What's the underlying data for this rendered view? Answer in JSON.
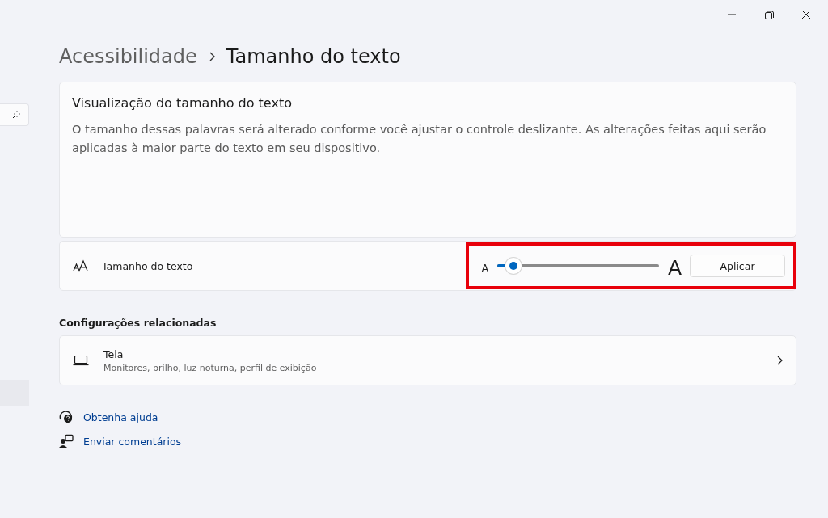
{
  "breadcrumb": {
    "parent": "Acessibilidade",
    "current": "Tamanho do texto"
  },
  "preview": {
    "title": "Visualização do tamanho do texto",
    "body": "O tamanho dessas palavras será alterado conforme você ajustar o controle deslizante. As alterações feitas aqui serão aplicadas à maior parte do texto em seu dispositivo."
  },
  "text_size": {
    "label": "Tamanho do texto",
    "small_letter": "A",
    "large_letter": "A",
    "level": 0.1,
    "apply_button": "Aplicar",
    "highlighted": true
  },
  "related": {
    "heading": "Configurações relacionadas",
    "items": [
      {
        "title": "Tela",
        "subtitle": "Monitores, brilho, luz noturna, perfil de exibição"
      }
    ]
  },
  "links": [
    {
      "kind": "help",
      "label": "Obtenha ajuda"
    },
    {
      "kind": "feedback",
      "label": "Enviar comentários"
    }
  ],
  "sidebar": {
    "selected_item": true
  }
}
